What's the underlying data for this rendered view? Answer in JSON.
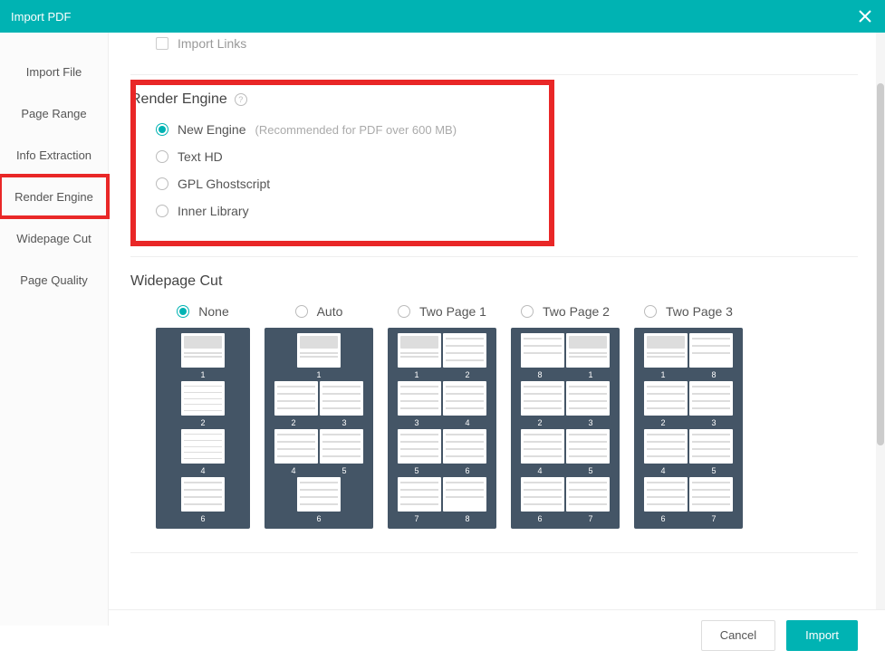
{
  "titlebar": {
    "title": "Import PDF"
  },
  "sidebar": {
    "items": [
      {
        "label": "Import File"
      },
      {
        "label": "Page Range"
      },
      {
        "label": "Info Extraction"
      },
      {
        "label": "Render Engine",
        "highlighted": true
      },
      {
        "label": "Widepage Cut"
      },
      {
        "label": "Page Quality"
      }
    ]
  },
  "truncated": {
    "import_links": "Import Links"
  },
  "render_engine": {
    "heading": "Render Engine",
    "options": [
      {
        "label": "New Engine",
        "hint": "(Recommended for PDF over 600 MB)",
        "checked": true
      },
      {
        "label": "Text HD",
        "checked": false
      },
      {
        "label": "GPL Ghostscript",
        "checked": false
      },
      {
        "label": "Inner Library",
        "checked": false
      }
    ]
  },
  "widepage": {
    "heading": "Widepage Cut",
    "options": [
      {
        "label": "None",
        "checked": true
      },
      {
        "label": "Auto",
        "checked": false
      },
      {
        "label": "Two Page 1",
        "checked": false
      },
      {
        "label": "Two Page 2",
        "checked": false
      },
      {
        "label": "Two Page 3",
        "checked": false
      }
    ]
  },
  "footer": {
    "cancel": "Cancel",
    "import": "Import"
  }
}
